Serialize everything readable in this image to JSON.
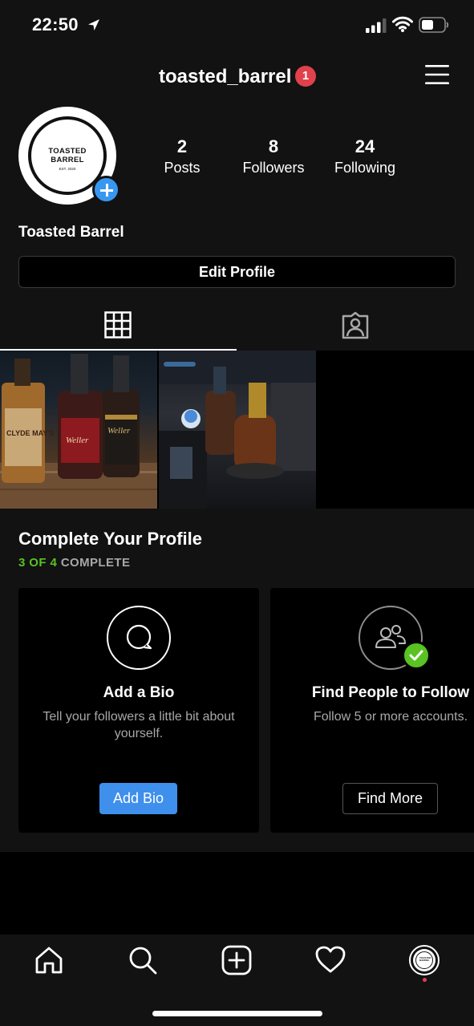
{
  "status_bar": {
    "time": "22:50",
    "icons": [
      "location-arrow-icon",
      "cellular-signal-icon",
      "wifi-icon",
      "battery-icon"
    ]
  },
  "header": {
    "username": "toasted_barrel",
    "notification_count": "1",
    "menu_icon": "hamburger-menu-icon"
  },
  "profile": {
    "avatar_text": "TOASTED BARREL",
    "avatar_subtext": "EST. 2020",
    "display_name": "Toasted Barrel",
    "stats": [
      {
        "value": "2",
        "label": "Posts"
      },
      {
        "value": "8",
        "label": "Followers"
      },
      {
        "value": "24",
        "label": "Following"
      }
    ],
    "edit_button": "Edit Profile"
  },
  "tabs": [
    {
      "name": "grid",
      "icon": "grid-icon",
      "active": true
    },
    {
      "name": "tagged",
      "icon": "tagged-person-icon",
      "active": false
    }
  ],
  "posts": [
    {
      "description": "Bourbon bottles on wooden table",
      "bottle_labels": [
        "CLYDE MAY'S",
        "Weller",
        "Weller"
      ]
    },
    {
      "description": "Bourbon bottles in car cup holder",
      "bottle_labels": []
    }
  ],
  "complete_profile": {
    "title": "Complete Your Profile",
    "progress_done": "3 OF 4",
    "progress_label": "COMPLETE",
    "cards": [
      {
        "icon": "speech-bubble-icon",
        "title": "Add a Bio",
        "description": "Tell your followers a little bit about yourself.",
        "button": "Add Bio",
        "completed": false
      },
      {
        "icon": "people-icon",
        "title": "Find People to Follow",
        "description": "Follow 5 or more accounts.",
        "button": "Find More",
        "completed": true
      }
    ]
  },
  "bottom_nav": {
    "items": [
      "home-icon",
      "search-icon",
      "new-post-icon",
      "activity-heart-icon",
      "profile-avatar"
    ]
  },
  "colors": {
    "background": "#121212",
    "accent_blue": "#3f8fec",
    "progress_green": "#58c322",
    "badge_red": "#e0414c"
  }
}
